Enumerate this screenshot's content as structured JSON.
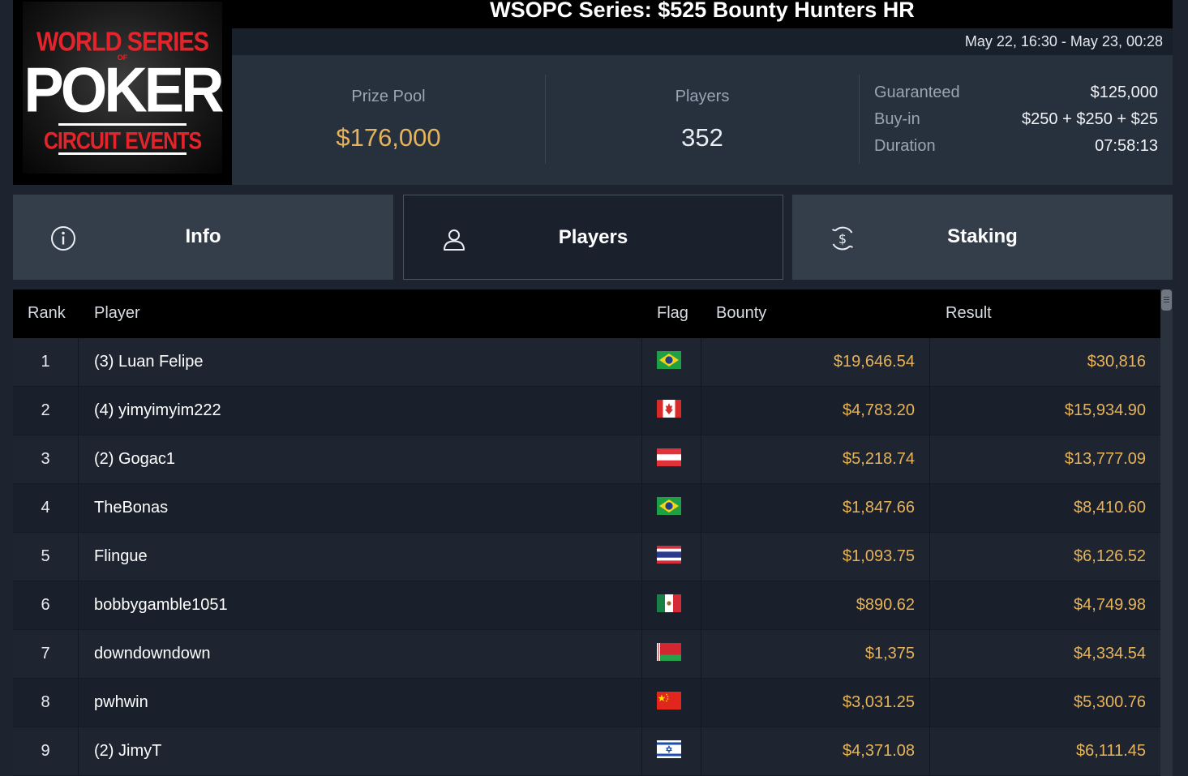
{
  "logo": {
    "line1": "WORLD SERIES",
    "of": "OF",
    "line2": "POKER",
    "line3": "CIRCUIT EVENTS"
  },
  "header": {
    "title": "WSOPC Series: $525 Bounty Hunters HR",
    "date_range": "May 22, 16:30 - May 23, 00:28"
  },
  "stats": {
    "prize_pool_label": "Prize Pool",
    "prize_pool_value": "$176,000",
    "players_label": "Players",
    "players_value": "352",
    "guaranteed_label": "Guaranteed",
    "guaranteed_value": "$125,000",
    "buyin_label": "Buy-in",
    "buyin_value": "$250 + $250 + $25",
    "duration_label": "Duration",
    "duration_value": "07:58:13"
  },
  "tabs": [
    {
      "label": "Info",
      "icon": "info-icon",
      "active": false
    },
    {
      "label": "Players",
      "icon": "user-icon",
      "active": true
    },
    {
      "label": "Staking",
      "icon": "dollar-coin-icon",
      "active": false
    }
  ],
  "table": {
    "columns": {
      "rank": "Rank",
      "player": "Player",
      "flag": "Flag",
      "bounty": "Bounty",
      "result": "Result"
    },
    "rows": [
      {
        "rank": "1",
        "player": "(3) Luan Felipe",
        "flag": "brazil-flag",
        "bounty": "$19,646.54",
        "result": "$30,816"
      },
      {
        "rank": "2",
        "player": "(4) yimyimyim222",
        "flag": "canada-flag",
        "bounty": "$4,783.20",
        "result": "$15,934.90"
      },
      {
        "rank": "3",
        "player": "(2) Gogac1",
        "flag": "austria-flag",
        "bounty": "$5,218.74",
        "result": "$13,777.09"
      },
      {
        "rank": "4",
        "player": "TheBonas",
        "flag": "brazil-flag",
        "bounty": "$1,847.66",
        "result": "$8,410.60"
      },
      {
        "rank": "5",
        "player": "Flingue",
        "flag": "thailand-flag",
        "bounty": "$1,093.75",
        "result": "$6,126.52"
      },
      {
        "rank": "6",
        "player": "bobbygamble1051",
        "flag": "mexico-flag",
        "bounty": "$890.62",
        "result": "$4,749.98"
      },
      {
        "rank": "7",
        "player": "downdowndown",
        "flag": "belarus-flag",
        "bounty": "$1,375",
        "result": "$4,334.54"
      },
      {
        "rank": "8",
        "player": "pwhwin",
        "flag": "china-flag",
        "bounty": "$3,031.25",
        "result": "$5,300.76"
      },
      {
        "rank": "9",
        "player": "(2) JimyT",
        "flag": "israel-flag",
        "bounty": "$4,371.08",
        "result": "$6,111.45"
      }
    ]
  },
  "colors": {
    "gold": "#e6b35a",
    "background": "#1d2430",
    "panel": "#27303d",
    "tab": "#343e4b"
  }
}
